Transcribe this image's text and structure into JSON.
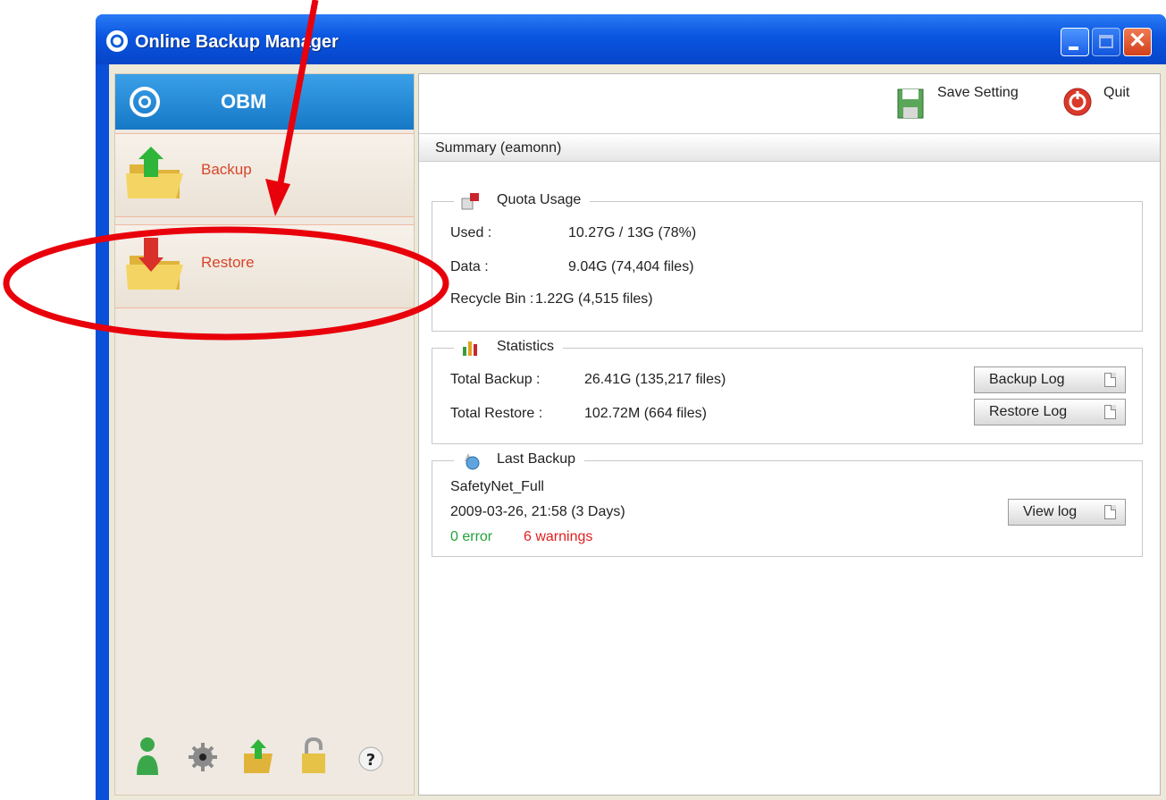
{
  "window": {
    "title": "Online Backup Manager"
  },
  "sidebar": {
    "brand": "OBM",
    "items": [
      {
        "label": "Backup",
        "icon": "folder-up-arrow-icon"
      },
      {
        "label": "Restore",
        "icon": "folder-down-arrow-icon"
      }
    ],
    "bottom_icons": [
      "user-icon",
      "gear-icon",
      "backup-folder-icon",
      "lock-icon",
      "help-icon"
    ]
  },
  "toolbar": {
    "save_label": "Save Setting",
    "quit_label": "Quit"
  },
  "summary": {
    "title": "Summary (eamonn)",
    "quota": {
      "title": "Quota Usage",
      "used_label": "Used :",
      "used_value": "10.27G / 13G (78%)",
      "data_label": "Data :",
      "data_value": "9.04G  (74,404 files)",
      "recycle_label": "Recycle Bin :",
      "recycle_value": "1.22G  (4,515 files)"
    },
    "statistics": {
      "title": "Statistics",
      "total_backup_label": "Total Backup :",
      "total_backup_value": "26.41G  (135,217 files)",
      "total_restore_label": "Total Restore :",
      "total_restore_value": "102.72M  (664 files)",
      "backup_log_button": "Backup Log",
      "restore_log_button": "Restore Log"
    },
    "last_backup": {
      "title": "Last Backup",
      "set_name": "SafetyNet_Full",
      "datetime": "2009-03-26, 21:58 (3 Days)",
      "errors": "0 error",
      "warnings": "6 warnings",
      "view_log_button": "View log"
    }
  },
  "colors": {
    "annotation": "#e8000b",
    "nav_label": "#d8452a",
    "accent_blue": "#1678c6"
  }
}
